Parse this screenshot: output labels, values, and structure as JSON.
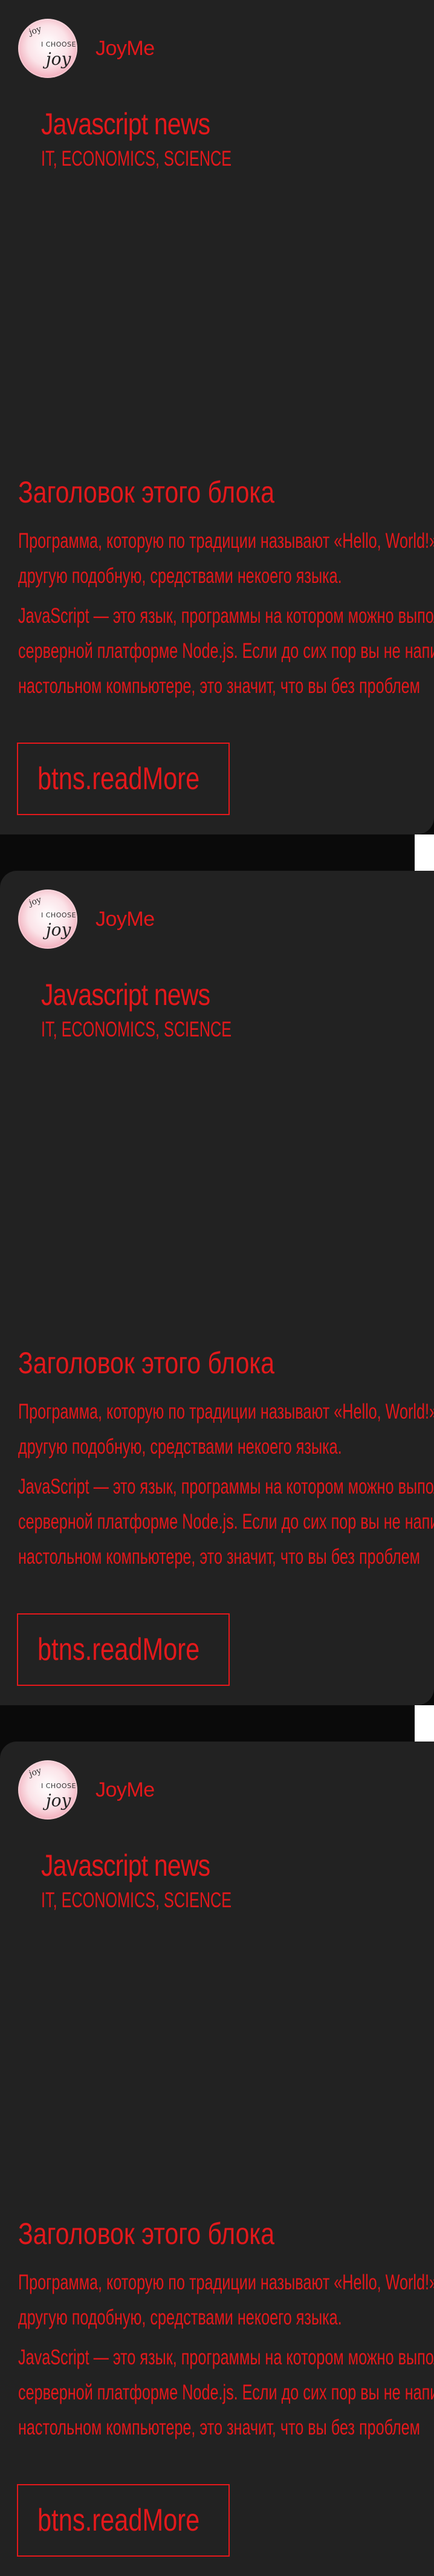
{
  "colors": {
    "accent": "#e4181b",
    "card_background": "#222222",
    "page_background": "#0a0a0a"
  },
  "cards": [
    {
      "author": {
        "name": "JoyMe",
        "avatar_icon": "avatar-joy-icon",
        "avatar_text": [
          "joy",
          "I CHOOSE",
          "joy"
        ]
      },
      "intro": {
        "title": "Javascript news",
        "tags": "IT, ECONOMICS, SCIENCE"
      },
      "block": {
        "title": "Заголовок этого блока",
        "paragraph1_line1": "Программа, которую по традиции называют «Hello, World!»,",
        "paragraph1_line2": "другую подобную, средствами некоего языка.",
        "paragraph2_line1": "JavaScript — это язык, программы на котором можно выполнять",
        "paragraph2_line2": "серверной платформе Node.js. Если до сих пор вы не написали",
        "paragraph2_line3": "настольном компьютере, это значит, что вы без проблем"
      },
      "read_more_label": "btns.readMore"
    },
    {
      "author": {
        "name": "JoyMe",
        "avatar_icon": "avatar-joy-icon",
        "avatar_text": [
          "joy",
          "I CHOOSE",
          "joy"
        ]
      },
      "intro": {
        "title": "Javascript news",
        "tags": "IT, ECONOMICS, SCIENCE"
      },
      "block": {
        "title": "Заголовок этого блока",
        "paragraph1_line1": "Программа, которую по традиции называют «Hello, World!»,",
        "paragraph1_line2": "другую подобную, средствами некоего языка.",
        "paragraph2_line1": "JavaScript — это язык, программы на котором можно выполнять",
        "paragraph2_line2": "серверной платформе Node.js. Если до сих пор вы не написали",
        "paragraph2_line3": "настольном компьютере, это значит, что вы без проблем"
      },
      "read_more_label": "btns.readMore"
    },
    {
      "author": {
        "name": "JoyMe",
        "avatar_icon": "avatar-joy-icon",
        "avatar_text": [
          "joy",
          "I CHOOSE",
          "joy"
        ]
      },
      "intro": {
        "title": "Javascript news",
        "tags": "IT, ECONOMICS, SCIENCE"
      },
      "block": {
        "title": "Заголовок этого блока",
        "paragraph1_line1": "Программа, которую по традиции называют «Hello, World!»,",
        "paragraph1_line2": "другую подобную, средствами некоего языка.",
        "paragraph2_line1": "JavaScript — это язык, программы на котором можно выполнять",
        "paragraph2_line2": "серверной платформе Node.js. Если до сих пор вы не написали",
        "paragraph2_line3": "настольном компьютере, это значит, что вы без проблем"
      },
      "read_more_label": "btns.readMore"
    }
  ]
}
